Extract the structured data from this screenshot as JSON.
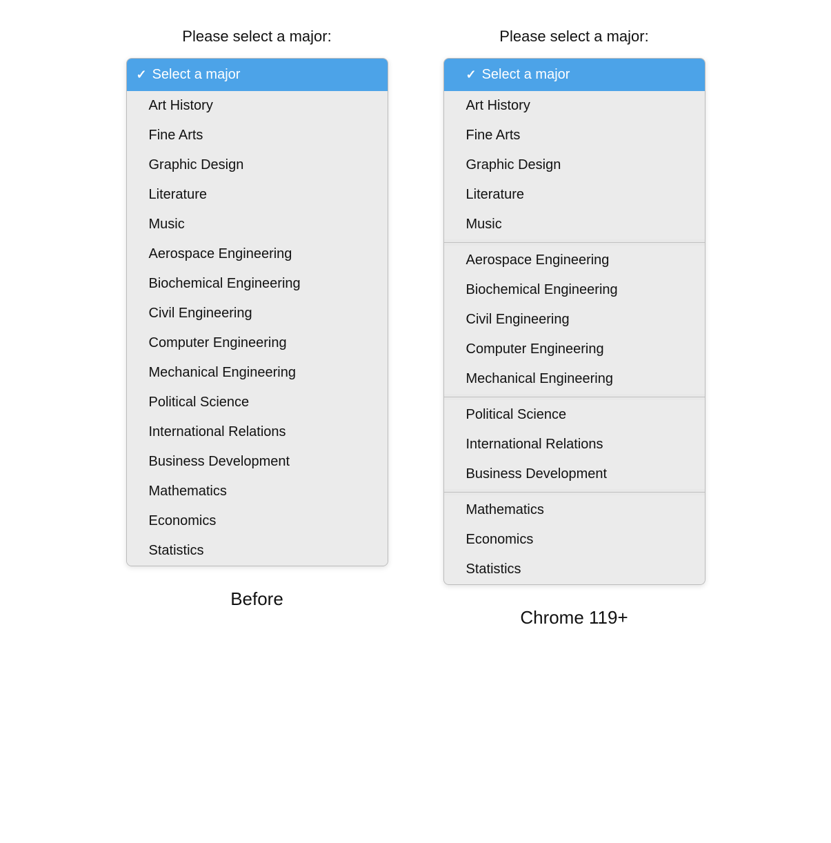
{
  "columns": [
    {
      "id": "before",
      "title": "Please select a major:",
      "label": "Before",
      "selected": "Select a major",
      "grouped": false,
      "groups": [
        {
          "items": [
            "Art History",
            "Fine Arts",
            "Graphic Design",
            "Literature",
            "Music",
            "Aerospace Engineering",
            "Biochemical Engineering",
            "Civil Engineering",
            "Computer Engineering",
            "Mechanical Engineering",
            "Political Science",
            "International Relations",
            "Business Development",
            "Mathematics",
            "Economics",
            "Statistics"
          ]
        }
      ]
    },
    {
      "id": "chrome119",
      "title": "Please select a major:",
      "label": "Chrome 119+",
      "selected": "Select a major",
      "grouped": true,
      "groups": [
        {
          "items": [
            "Art History",
            "Fine Arts",
            "Graphic Design",
            "Literature",
            "Music"
          ]
        },
        {
          "items": [
            "Aerospace Engineering",
            "Biochemical Engineering",
            "Civil Engineering",
            "Computer Engineering",
            "Mechanical Engineering"
          ]
        },
        {
          "items": [
            "Political Science",
            "International Relations",
            "Business Development"
          ]
        },
        {
          "items": [
            "Mathematics",
            "Economics",
            "Statistics"
          ]
        }
      ]
    }
  ],
  "checkmark": "✓"
}
